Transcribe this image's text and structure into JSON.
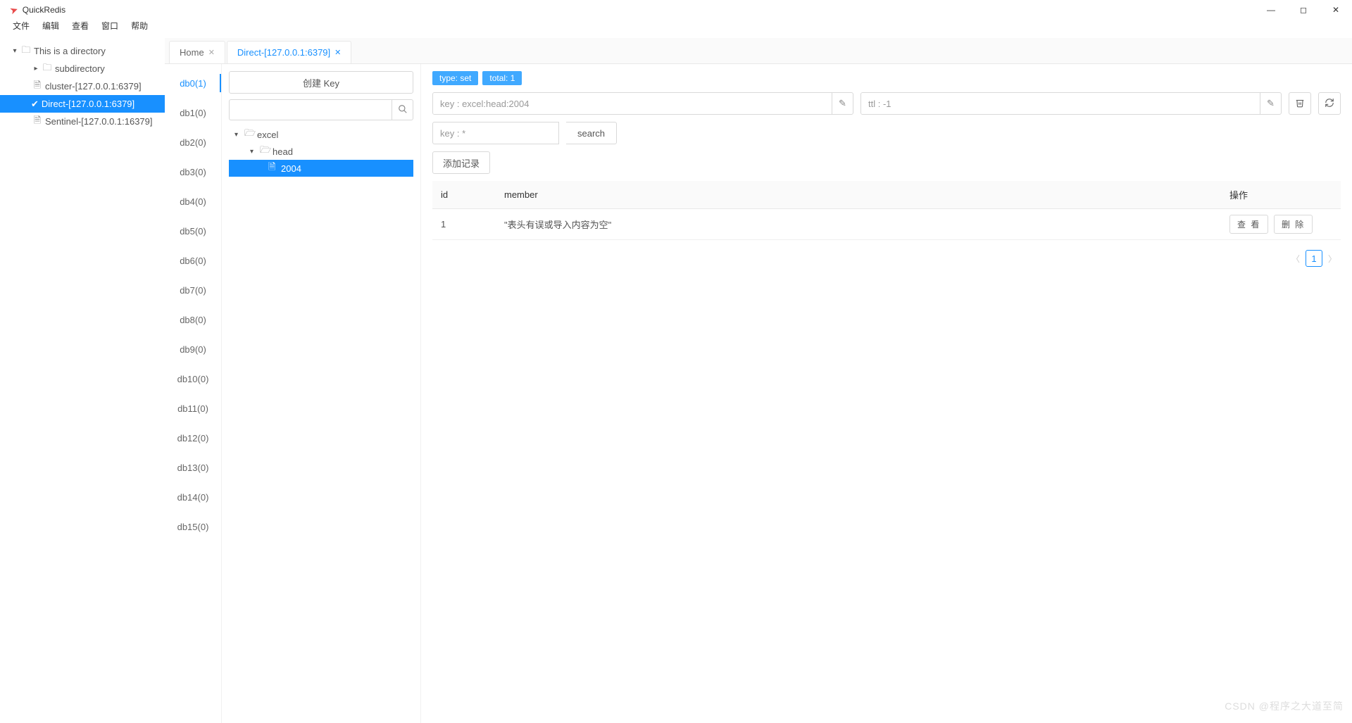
{
  "app": {
    "title": "QuickRedis"
  },
  "menubar": {
    "items": [
      "文件",
      "编辑",
      "查看",
      "窗口",
      "帮助"
    ]
  },
  "sidebar": {
    "root": {
      "label": "This is a directory"
    },
    "sub": {
      "label": "subdirectory"
    },
    "conn0": {
      "label": "cluster-[127.0.0.1:6379]"
    },
    "conn1": {
      "label": "Direct-[127.0.0.1:6379]"
    },
    "conn2": {
      "label": "Sentinel-[127.0.0.1:16379]"
    }
  },
  "tabs": {
    "home": "Home",
    "direct": "Direct-[127.0.0.1:6379]"
  },
  "dblist": [
    "db0(1)",
    "db1(0)",
    "db2(0)",
    "db3(0)",
    "db4(0)",
    "db5(0)",
    "db6(0)",
    "db7(0)",
    "db8(0)",
    "db9(0)",
    "db10(0)",
    "db11(0)",
    "db12(0)",
    "db13(0)",
    "db14(0)",
    "db15(0)"
  ],
  "keypanel": {
    "create": "创建 Key",
    "tree": {
      "l0": "excel",
      "l1": "head",
      "l2": "2004"
    }
  },
  "detail": {
    "type_badge": "type: set",
    "total_badge": "total: 1",
    "key_value": "key : excel:head:2004",
    "ttl_value": "ttl : -1",
    "filter_value": "key : *",
    "search_btn": "search",
    "add_record": "添加记录",
    "columns": {
      "id": "id",
      "member": "member",
      "op": "操作"
    },
    "rows": [
      {
        "id": "1",
        "member": "\"表头有误或导入内容为空\""
      }
    ],
    "view_btn": "查 看",
    "delete_btn": "删 除",
    "page": "1"
  },
  "watermark": "CSDN @程序之大道至简"
}
